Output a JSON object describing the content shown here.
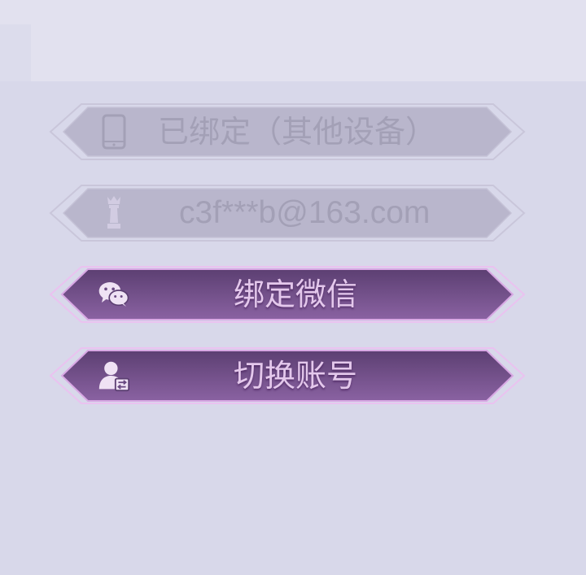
{
  "buttons": [
    {
      "id": "device",
      "label": "已绑定（其他设备）",
      "icon": "phone-icon",
      "state": "disabled"
    },
    {
      "id": "email",
      "label": "c3f***b@163.com",
      "icon": "chess-king-icon",
      "state": "disabled"
    },
    {
      "id": "wechat",
      "label": "绑定微信",
      "icon": "wechat-icon",
      "state": "active"
    },
    {
      "id": "switch",
      "label": "切换账号",
      "icon": "user-switch-icon",
      "state": "active"
    }
  ],
  "colors": {
    "background": "#d8d8ea",
    "disabled_fill": "#b9b6cc",
    "disabled_text": "#a3a0b6",
    "active_fill_top": "#5c3f72",
    "active_fill_bottom": "#8a62a2",
    "active_text": "#e4c8ec",
    "active_border": "#e6b8ee"
  }
}
